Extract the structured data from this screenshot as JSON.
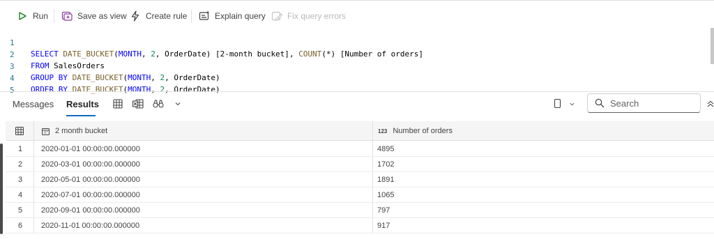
{
  "toolbar": {
    "run": "Run",
    "save_as_view": "Save as view",
    "create_rule": "Create rule",
    "explain_query": "Explain query",
    "fix_query_errors": "Fix query errors"
  },
  "editor": {
    "lines": [
      {
        "num": "1"
      },
      {
        "num": "2"
      },
      {
        "num": "3"
      },
      {
        "num": "4"
      },
      {
        "num": "5"
      }
    ],
    "tokens": {
      "select": "SELECT",
      "date_bucket": "DATE_BUCKET",
      "month": "MONTH",
      "two": "2",
      "orderdate": "OrderDate",
      "alias1": "[2-month bucket]",
      "count": "COUNT",
      "star": "(*)",
      "alias2": "[Number of orders]",
      "from": "FROM",
      "table": "SalesOrders",
      "group_by": "GROUP BY",
      "order_by": "ORDER BY"
    }
  },
  "results": {
    "tabs": [
      "Messages",
      "Results"
    ],
    "search_placeholder": "Search",
    "columns": [
      {
        "label": "2 month bucket",
        "type_icon": "calendar-icon"
      },
      {
        "label": "Number of orders",
        "type_icon": "number-123-icon",
        "type_text": "123"
      }
    ],
    "rows": [
      {
        "index": "1",
        "bucket": "2020-01-01 00:00:00.000000",
        "orders": "4895"
      },
      {
        "index": "2",
        "bucket": "2020-03-01 00:00:00.000000",
        "orders": "1702"
      },
      {
        "index": "3",
        "bucket": "2020-05-01 00:00:00.000000",
        "orders": "1891"
      },
      {
        "index": "4",
        "bucket": "2020-07-01 00:00:00.000000",
        "orders": "1065"
      },
      {
        "index": "5",
        "bucket": "2020-09-01 00:00:00.000000",
        "orders": "797"
      },
      {
        "index": "6",
        "bucket": "2020-11-01 00:00:00.000000",
        "orders": "917"
      }
    ]
  },
  "colors": {
    "accent": "#0f6cbd",
    "keyword": "#0000ff",
    "function": "#795e26",
    "number": "#098658",
    "line_number": "#237893"
  }
}
